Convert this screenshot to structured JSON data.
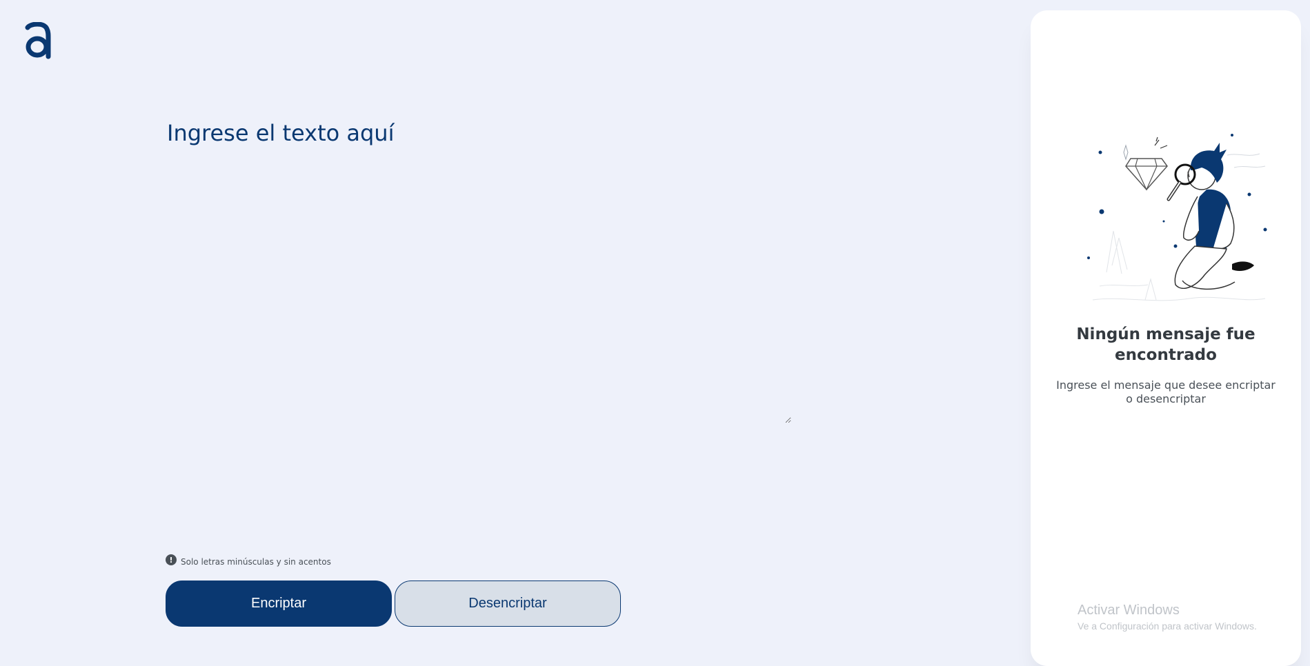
{
  "app": {
    "logo_icon": "alura-a-logo-icon"
  },
  "editor": {
    "placeholder": "Ingrese el texto aquí",
    "value": ""
  },
  "hint": {
    "icon": "info-exclamation-icon",
    "text": "Solo letras minúsculas y sin acentos"
  },
  "actions": {
    "encrypt_label": "Encriptar",
    "decrypt_label": "Desencriptar"
  },
  "output_panel": {
    "illustration": "boy-with-magnifying-glass-illustration",
    "title": "Ningún mensaje fue encontrado",
    "description": "Ingrese el mensaje que desee encriptar o desencriptar"
  },
  "windows_watermark": {
    "title": "Activar Windows",
    "subtitle": "Ve a Configuración para activar Windows."
  },
  "colors": {
    "background": "#eef1fa",
    "primary": "#0a3871",
    "secondary_button": "#d8dfe8",
    "panel": "#ffffff"
  }
}
